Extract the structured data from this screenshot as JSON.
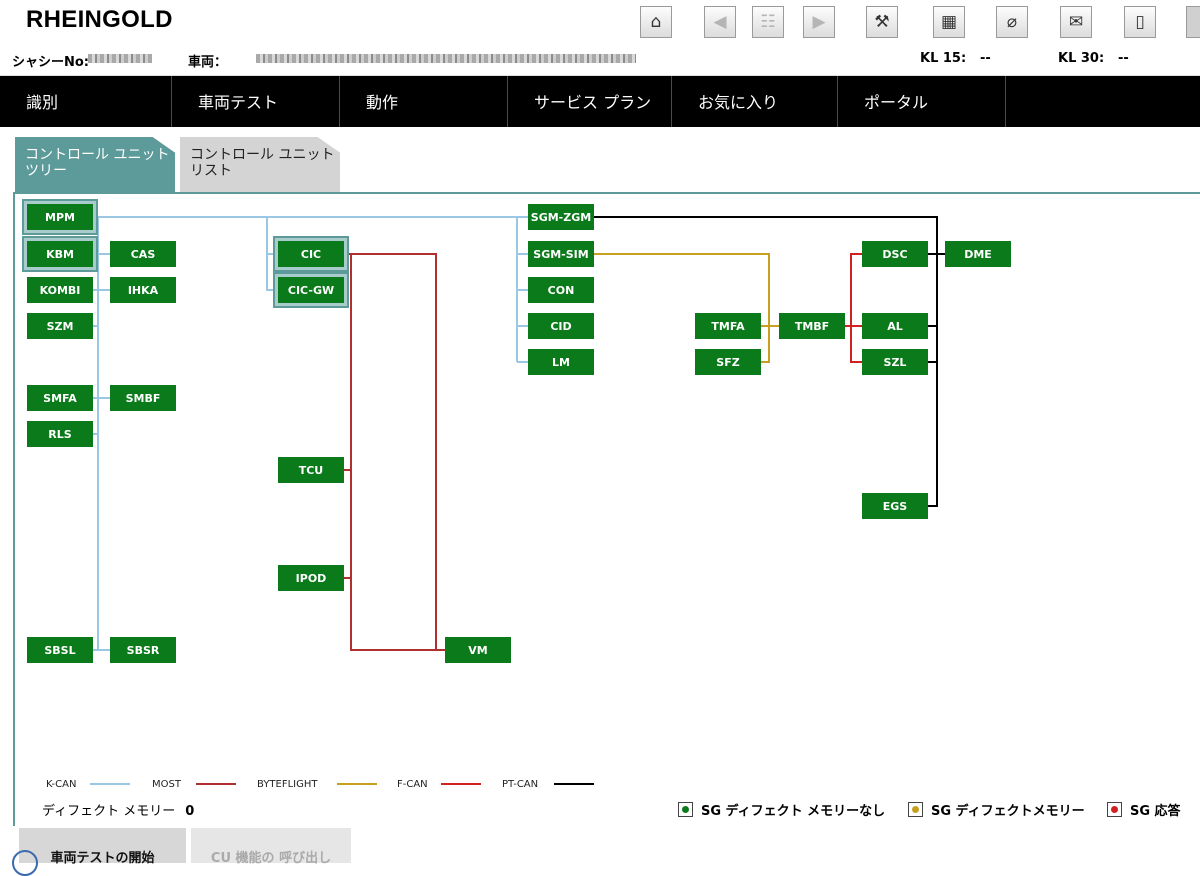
{
  "app": {
    "title": "RHEINGOLD"
  },
  "toolbar": {
    "buttons": [
      {
        "name": "home-icon",
        "glyph": "⌂",
        "enabled": true
      },
      {
        "name": "back-icon",
        "glyph": "◀",
        "enabled": false
      },
      {
        "name": "clipboard-icon",
        "glyph": "☷",
        "enabled": false
      },
      {
        "name": "forward-icon",
        "glyph": "▶",
        "enabled": false
      },
      {
        "name": "wrench-icon",
        "glyph": "⚒",
        "enabled": true
      },
      {
        "name": "module-icon",
        "glyph": "▦",
        "enabled": true
      },
      {
        "name": "connector-icon",
        "glyph": "⌀",
        "enabled": true
      },
      {
        "name": "mail-icon",
        "glyph": "✉",
        "enabled": true
      },
      {
        "name": "battery-icon",
        "glyph": "▯",
        "enabled": true
      }
    ]
  },
  "info": {
    "chassis_label": "シャシーNo:",
    "vehicle_label": "車両：",
    "kl15_label": "KL 15:",
    "kl15_value": "--",
    "kl30_label": "KL 30:",
    "kl30_value": "--"
  },
  "nav": {
    "items": [
      {
        "label": "識別",
        "state": "normal"
      },
      {
        "label": "車両テスト",
        "state": "active"
      },
      {
        "label": "動作",
        "state": "normal"
      },
      {
        "label": "サービス プラン",
        "state": "normal"
      },
      {
        "label": "お気に入り",
        "state": "normal"
      },
      {
        "label": "ポータル",
        "state": "disabled"
      },
      {
        "label": "",
        "state": "normal"
      }
    ]
  },
  "subtabs": {
    "tree_line1": "コントロール ユニット",
    "tree_line2": "ツリー",
    "list_line1": "コントロール ユニット",
    "list_line2": "リスト"
  },
  "colors": {
    "k_can": "#9ac8e4",
    "most": "#b03030",
    "byteflight": "#c8a020",
    "f_can": "#d02020",
    "pt_can": "#000000",
    "node_green": "#0a7a1a",
    "accent": "#5d9a9a"
  },
  "network": {
    "units": [
      {
        "id": "MPM",
        "selected": true
      },
      {
        "id": "KBM",
        "selected": true
      },
      {
        "id": "CAS",
        "selected": false
      },
      {
        "id": "KOMBI",
        "selected": false
      },
      {
        "id": "IHKA",
        "selected": false
      },
      {
        "id": "SZM",
        "selected": false
      },
      {
        "id": "SMFA",
        "selected": false
      },
      {
        "id": "SMBF",
        "selected": false
      },
      {
        "id": "RLS",
        "selected": false
      },
      {
        "id": "SBSL",
        "selected": false
      },
      {
        "id": "SBSR",
        "selected": false
      },
      {
        "id": "CIC",
        "selected": true
      },
      {
        "id": "CIC-GW",
        "selected": true
      },
      {
        "id": "TCU",
        "selected": false
      },
      {
        "id": "IPOD",
        "selected": false
      },
      {
        "id": "VM",
        "selected": false
      },
      {
        "id": "SGM-ZGM",
        "selected": false
      },
      {
        "id": "SGM-SIM",
        "selected": false
      },
      {
        "id": "CON",
        "selected": false
      },
      {
        "id": "CID",
        "selected": false
      },
      {
        "id": "LM",
        "selected": false
      },
      {
        "id": "TMFA",
        "selected": false
      },
      {
        "id": "SFZ",
        "selected": false
      },
      {
        "id": "TMBF",
        "selected": false
      },
      {
        "id": "DSC",
        "selected": false
      },
      {
        "id": "DME",
        "selected": false
      },
      {
        "id": "AL",
        "selected": false
      },
      {
        "id": "SZL",
        "selected": false
      },
      {
        "id": "EGS",
        "selected": false
      }
    ],
    "buses": [
      "K-CAN",
      "MOST",
      "BYTEFLIGHT",
      "F-CAN",
      "PT-CAN"
    ]
  },
  "defect": {
    "label": "ディフェクト メモリー",
    "count": "0"
  },
  "status_legend": {
    "none": "SG ディフェクト メモリーなし",
    "present": "SG ディフェクトメモリー",
    "no_response": "SG 応答"
  },
  "bottom": {
    "start_test": "車両テストの開始",
    "call_cu": "CU 機能の 呼び出し"
  }
}
